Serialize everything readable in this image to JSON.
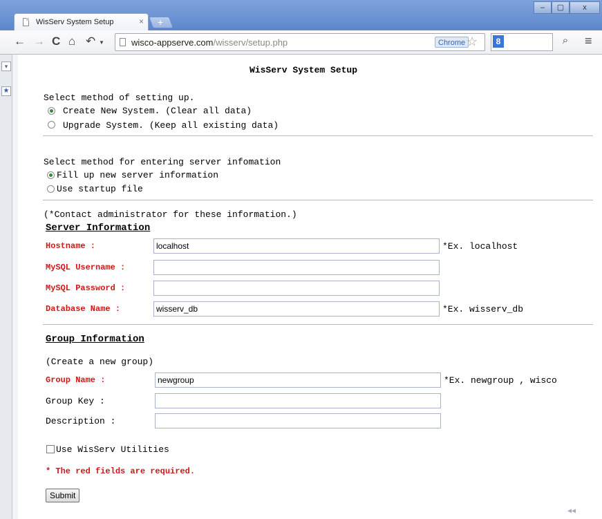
{
  "browser": {
    "tab_title": "WisServ System Setup",
    "tab_close": "×",
    "new_tab": "+",
    "win_min": "–",
    "win_max": "▢",
    "win_close": "x",
    "url_host": "wisco-appserve.com",
    "url_path": "/wisserv/setup.php",
    "chrome_badge": "Chrome",
    "search_engine": "8",
    "icons": {
      "back": "←",
      "forward": "→",
      "reload": "C",
      "home": "⌂",
      "undo": "↶",
      "star": "☆",
      "search": "🔍",
      "menu": "≡"
    }
  },
  "page": {
    "title": "WisServ System Setup",
    "setup_method": {
      "prompt": "Select method of setting up.",
      "options": [
        "Create New System. (Clear all data)",
        "Upgrade System. (Keep all existing data)"
      ],
      "selected": 0
    },
    "entry_method": {
      "prompt": "Select method for entering server infomation",
      "options": [
        "Fill up new server information",
        "Use startup file"
      ],
      "selected": 0
    },
    "contact_note": "(*Contact administrator for these information.)",
    "server": {
      "heading": "Server Information",
      "hostname": {
        "label": "Hostname :",
        "value": "localhost",
        "hint": "*Ex. localhost"
      },
      "username": {
        "label": "MySQL Username :",
        "value": ""
      },
      "password": {
        "label": "MySQL Password :",
        "value": ""
      },
      "database": {
        "label": "Database Name :",
        "value": "wisserv_db",
        "hint": "*Ex. wisserv_db"
      }
    },
    "group": {
      "heading": "Group Information",
      "note": "(Create a new group)",
      "name": {
        "label": "Group Name :",
        "value": "newgroup",
        "hint": "*Ex. newgroup , wisco"
      },
      "key": {
        "label": "Group Key :",
        "value": ""
      },
      "description": {
        "label": "Description :",
        "value": ""
      }
    },
    "utilities_label": "Use WisServ Utilities",
    "required_note": "* The red fields are required.",
    "submit_label": "Submit"
  }
}
